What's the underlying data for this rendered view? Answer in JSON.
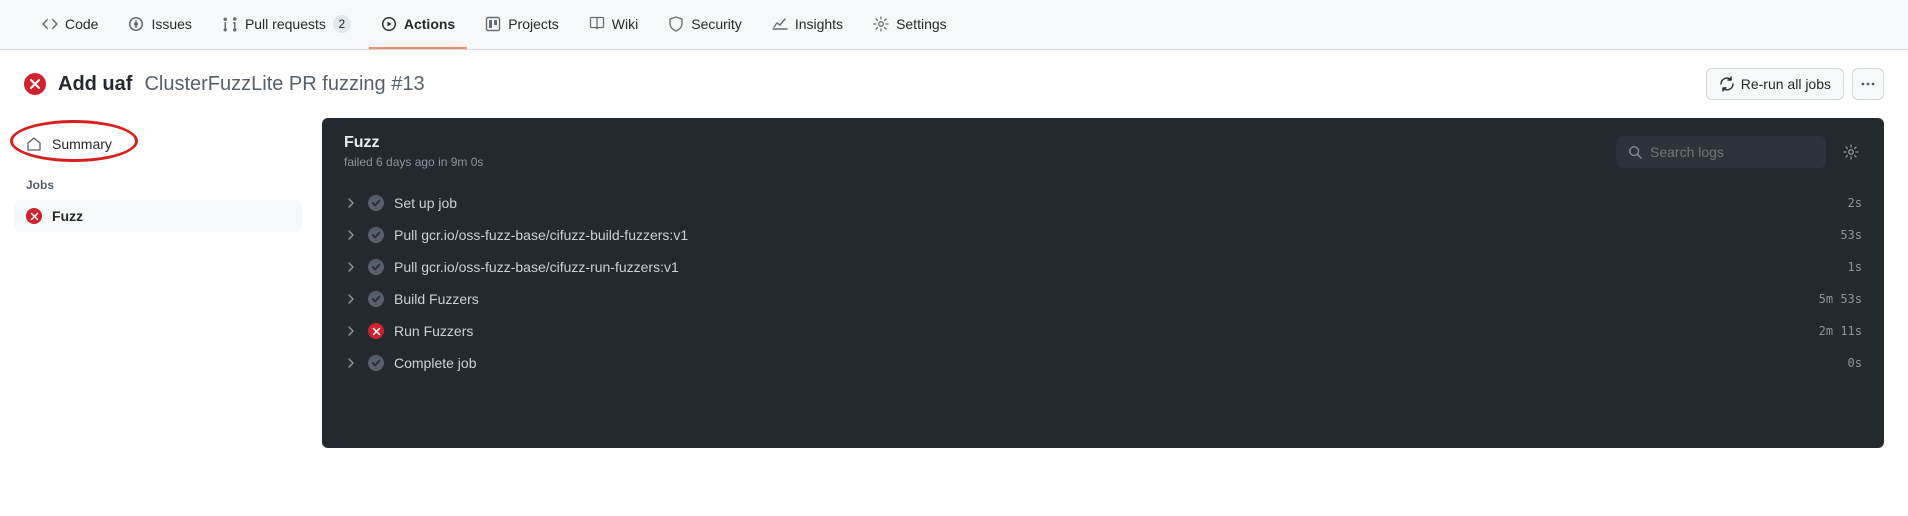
{
  "nav": {
    "code": "Code",
    "issues": "Issues",
    "pulls": "Pull requests",
    "pulls_count": "2",
    "actions": "Actions",
    "projects": "Projects",
    "wiki": "Wiki",
    "security": "Security",
    "insights": "Insights",
    "settings": "Settings"
  },
  "header": {
    "title_bold": "Add uaf",
    "title_sub": "ClusterFuzzLite PR fuzzing #13",
    "rerun_label": "Re-run all jobs"
  },
  "sidebar": {
    "summary_label": "Summary",
    "jobs_heading": "Jobs",
    "job_name": "Fuzz"
  },
  "panel": {
    "title": "Fuzz",
    "subtitle": "failed 6 days ago in 9m 0s",
    "search_placeholder": "Search logs"
  },
  "steps": [
    {
      "name": "Set up job",
      "status": "ok",
      "time": "2s"
    },
    {
      "name": "Pull gcr.io/oss-fuzz-base/cifuzz-build-fuzzers:v1",
      "status": "ok",
      "time": "53s"
    },
    {
      "name": "Pull gcr.io/oss-fuzz-base/cifuzz-run-fuzzers:v1",
      "status": "ok",
      "time": "1s"
    },
    {
      "name": "Build Fuzzers",
      "status": "ok",
      "time": "5m 53s"
    },
    {
      "name": "Run Fuzzers",
      "status": "fail",
      "time": "2m 11s"
    },
    {
      "name": "Complete job",
      "status": "ok",
      "time": "0s"
    }
  ]
}
